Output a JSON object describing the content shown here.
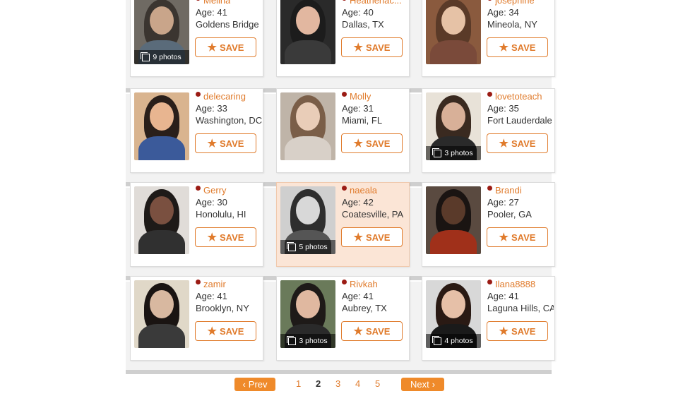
{
  "colors": {
    "accent": "#e07b2c",
    "online": "#9b1b14",
    "highlight": "#fbe5d6"
  },
  "save_label": "SAVE",
  "icons": {
    "save": "star-icon",
    "online": "online-dot-icon",
    "photos": "photo-stack-icon"
  },
  "profiles": [
    {
      "username": "Melina",
      "age": "Age: 41",
      "location": "Goldens Bridge",
      "photos": "9 photos"
    },
    {
      "username": "Heatherlac...",
      "age": "Age: 40",
      "location": "Dallas, TX",
      "photos": ""
    },
    {
      "username": "josephine",
      "age": "Age: 34",
      "location": "Mineola, NY",
      "photos": ""
    },
    {
      "username": "delecaring",
      "age": "Age: 33",
      "location": "Washington, DC",
      "photos": ""
    },
    {
      "username": "Molly",
      "age": "Age: 31",
      "location": "Miami, FL",
      "photos": ""
    },
    {
      "username": "lovetoteach",
      "age": "Age: 35",
      "location": "Fort Lauderdale",
      "photos": "3 photos"
    },
    {
      "username": "Gerry",
      "age": "Age: 30",
      "location": "Honolulu, HI",
      "photos": ""
    },
    {
      "username": "naeala",
      "age": "Age: 42",
      "location": "Coatesville, PA",
      "photos": "5 photos",
      "highlighted": true
    },
    {
      "username": "Brandi",
      "age": "Age: 27",
      "location": "Pooler, GA",
      "photos": ""
    },
    {
      "username": "zamir",
      "age": "Age: 41",
      "location": "Brooklyn, NY",
      "photos": ""
    },
    {
      "username": "Rivkah",
      "age": "Age: 41",
      "location": "Aubrey, TX",
      "photos": "3 photos"
    },
    {
      "username": "Ilana8888",
      "age": "Age: 41",
      "location": "Laguna Hills, CA",
      "photos": "4 photos"
    }
  ],
  "pagination": {
    "prev_label": "Prev",
    "next_label": "Next",
    "pages": [
      "1",
      "2",
      "3",
      "4",
      "5"
    ],
    "current_page": "2"
  }
}
